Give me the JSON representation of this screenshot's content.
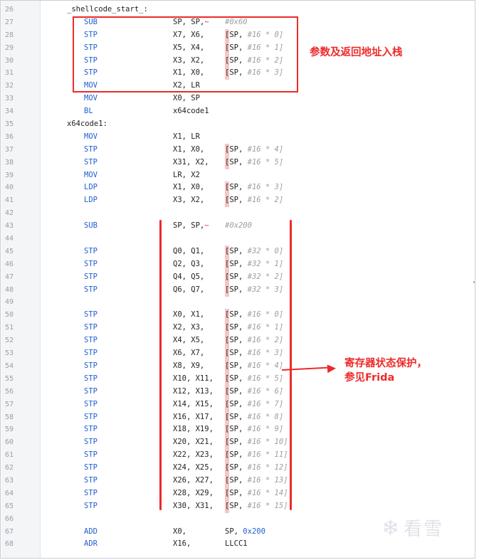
{
  "colors": {
    "mnemonic": "#1f5fd0",
    "annotation": "#ee2a2a",
    "comment": "#9aa0a6"
  },
  "lines": [
    {
      "n": "26",
      "label": "_shellcode_start_:"
    },
    {
      "n": "27",
      "op": "SUB",
      "a1": "SP, SP,",
      "squig": "~",
      "cmt": "#0x60"
    },
    {
      "n": "28",
      "op": "STP",
      "a1": "X7, X6,",
      "mem": "SP, ",
      "num": "#16 * 0"
    },
    {
      "n": "29",
      "op": "STP",
      "a1": "X5, X4,",
      "mem": "SP, ",
      "num": "#16 * 1"
    },
    {
      "n": "30",
      "op": "STP",
      "a1": "X3, X2,",
      "mem": "SP, ",
      "num": "#16 * 2"
    },
    {
      "n": "31",
      "op": "STP",
      "a1": "X1, X0,",
      "mem": "SP, ",
      "num": "#16 * 3"
    },
    {
      "n": "32",
      "op": "MOV",
      "a1": "X2, LR"
    },
    {
      "n": "33",
      "op": "MOV",
      "a1": "X0, SP"
    },
    {
      "n": "34",
      "op": "BL",
      "a1": "x64code1"
    },
    {
      "n": "35",
      "label": "x64code1:"
    },
    {
      "n": "36",
      "op": "MOV",
      "a1": "X1, LR"
    },
    {
      "n": "37",
      "op": "STP",
      "a1": "X1, X0,",
      "mem": "SP, ",
      "num": "#16 * 4"
    },
    {
      "n": "38",
      "op": "STP",
      "a1": "X31, X2,",
      "mem": "SP, ",
      "num": "#16 * 5"
    },
    {
      "n": "39",
      "op": "MOV",
      "a1": "LR, X2"
    },
    {
      "n": "40",
      "op": "LDP",
      "a1": "X1, X0,",
      "mem": "SP, ",
      "num": "#16 * 3"
    },
    {
      "n": "41",
      "op": "LDP",
      "a1": "X3, X2,",
      "mem": "SP, ",
      "num": "#16 * 2"
    },
    {
      "n": "42"
    },
    {
      "n": "43",
      "op": "SUB",
      "a1": "SP, SP,",
      "squig": "~",
      "cmt": "#0x200"
    },
    {
      "n": "44"
    },
    {
      "n": "45",
      "op": "STP",
      "a1": "Q0, Q1,",
      "mem": "SP, ",
      "num": "#32 * 0"
    },
    {
      "n": "46",
      "op": "STP",
      "a1": "Q2, Q3,",
      "mem": "SP, ",
      "num": "#32 * 1"
    },
    {
      "n": "47",
      "op": "STP",
      "a1": "Q4, Q5,",
      "mem": "SP, ",
      "num": "#32 * 2"
    },
    {
      "n": "48",
      "op": "STP",
      "a1": "Q6, Q7,",
      "mem": "SP, ",
      "num": "#32 * 3"
    },
    {
      "n": "49"
    },
    {
      "n": "50",
      "op": "STP",
      "a1": "X0, X1,",
      "mem": "SP, ",
      "num": "#16 * 0"
    },
    {
      "n": "51",
      "op": "STP",
      "a1": "X2, X3,",
      "mem": "SP, ",
      "num": "#16 * 1"
    },
    {
      "n": "52",
      "op": "STP",
      "a1": "X4, X5,",
      "mem": "SP, ",
      "num": "#16 * 2"
    },
    {
      "n": "53",
      "op": "STP",
      "a1": "X6, X7,",
      "mem": "SP, ",
      "num": "#16 * 3"
    },
    {
      "n": "54",
      "op": "STP",
      "a1": "X8, X9,",
      "mem": "SP, ",
      "num": "#16 * 4"
    },
    {
      "n": "55",
      "op": "STP",
      "a1": "X10, X11,",
      "mem": "SP, ",
      "num": "#16 * 5"
    },
    {
      "n": "56",
      "op": "STP",
      "a1": "X12, X13,",
      "mem": "SP, ",
      "num": "#16 * 6"
    },
    {
      "n": "57",
      "op": "STP",
      "a1": "X14, X15,",
      "mem": "SP, ",
      "num": "#16 * 7"
    },
    {
      "n": "58",
      "op": "STP",
      "a1": "X16, X17,",
      "mem": "SP, ",
      "num": "#16 * 8"
    },
    {
      "n": "59",
      "op": "STP",
      "a1": "X18, X19,",
      "mem": "SP, ",
      "num": "#16 * 9"
    },
    {
      "n": "60",
      "op": "STP",
      "a1": "X20, X21,",
      "mem": "SP, ",
      "num": "#16 * 10"
    },
    {
      "n": "61",
      "op": "STP",
      "a1": "X22, X23,",
      "mem": "SP, ",
      "num": "#16 * 11"
    },
    {
      "n": "62",
      "op": "STP",
      "a1": "X24, X25,",
      "mem": "SP, ",
      "num": "#16 * 12"
    },
    {
      "n": "63",
      "op": "STP",
      "a1": "X26, X27,",
      "mem": "SP, ",
      "num": "#16 * 13"
    },
    {
      "n": "64",
      "op": "STP",
      "a1": "X28, X29,",
      "mem": "SP, ",
      "num": "#16 * 14"
    },
    {
      "n": "65",
      "op": "STP",
      "a1": "X30, X31,",
      "mem": "SP, ",
      "num": "#16 * 15"
    },
    {
      "n": "66"
    },
    {
      "n": "67",
      "op": "ADD",
      "a1": "X0,",
      "a3": "SP, ",
      "hex": "0x200"
    },
    {
      "n": "68",
      "op": "ADR",
      "a1": "X16,",
      "a3": "LLCC1"
    }
  ],
  "annotations": {
    "box_note": "参数及返回地址入栈",
    "bar_note_line1": "寄存器状态保护，",
    "bar_note_line2": "参见Frida"
  },
  "watermark": {
    "icon": "snowflake-icon",
    "text": "看雪"
  }
}
